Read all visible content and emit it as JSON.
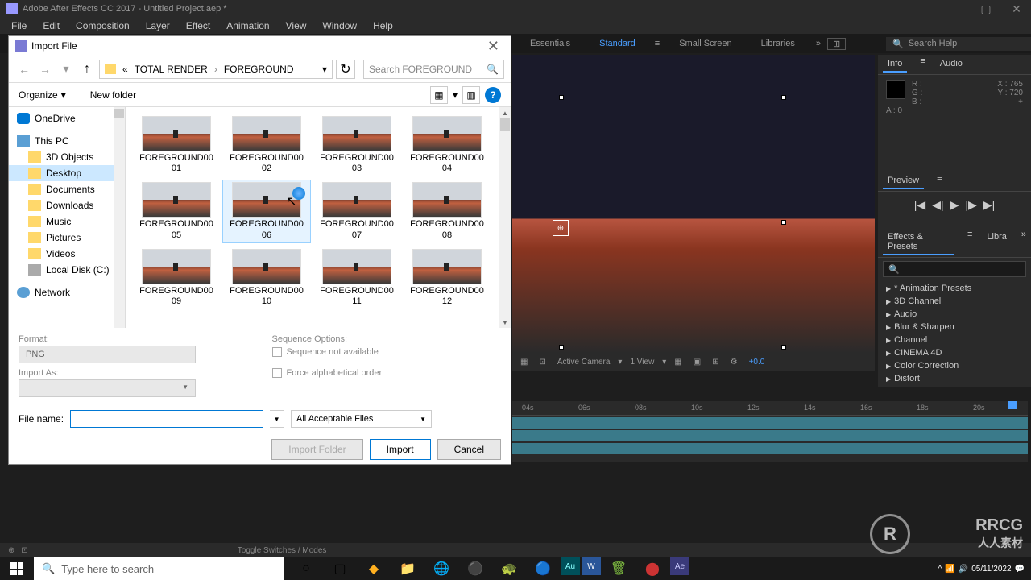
{
  "title_bar": {
    "title": "Adobe After Effects CC 2017 - Untitled Project.aep *"
  },
  "menu": {
    "items": [
      "File",
      "Edit",
      "Composition",
      "Layer",
      "Effect",
      "Animation",
      "View",
      "Window",
      "Help"
    ]
  },
  "workspace": {
    "tabs": [
      "Essentials",
      "Standard",
      "Small Screen",
      "Libraries"
    ],
    "active": "Standard",
    "search_placeholder": "Search Help"
  },
  "dialog": {
    "title": "Import File",
    "breadcrumb": {
      "prefix": "«",
      "parts": [
        "TOTAL RENDER",
        "FOREGROUND"
      ]
    },
    "search_placeholder": "Search FOREGROUND",
    "organize": "Organize",
    "new_folder": "New folder",
    "sidebar": {
      "items": [
        {
          "label": "OneDrive",
          "icon": "onedrive",
          "root": true
        },
        {
          "label": "This PC",
          "icon": "pc",
          "root": true
        },
        {
          "label": "3D Objects",
          "icon": "folder"
        },
        {
          "label": "Desktop",
          "icon": "folder",
          "selected": true
        },
        {
          "label": "Documents",
          "icon": "folder"
        },
        {
          "label": "Downloads",
          "icon": "folder"
        },
        {
          "label": "Music",
          "icon": "folder"
        },
        {
          "label": "Pictures",
          "icon": "folder"
        },
        {
          "label": "Videos",
          "icon": "folder"
        },
        {
          "label": "Local Disk (C:)",
          "icon": "drive"
        },
        {
          "label": "Network",
          "icon": "network",
          "root": true
        }
      ]
    },
    "files": [
      {
        "name": "FOREGROUND0001"
      },
      {
        "name": "FOREGROUND0002"
      },
      {
        "name": "FOREGROUND0003"
      },
      {
        "name": "FOREGROUND0004"
      },
      {
        "name": "FOREGROUND0005"
      },
      {
        "name": "FOREGROUND0006",
        "hover": true
      },
      {
        "name": "FOREGROUND0007"
      },
      {
        "name": "FOREGROUND0008"
      },
      {
        "name": "FOREGROUND0009"
      },
      {
        "name": "FOREGROUND0010"
      },
      {
        "name": "FOREGROUND0011"
      },
      {
        "name": "FOREGROUND0012"
      }
    ],
    "format_label": "Format:",
    "format_value": "PNG",
    "import_as_label": "Import As:",
    "import_as_value": "",
    "sequence_label": "Sequence Options:",
    "sequence_checkbox": "Sequence not available",
    "force_alpha": "Force alphabetical order",
    "filename_label": "File name:",
    "filename_value": "",
    "filetype": "All Acceptable Files",
    "btn_import_folder": "Import Folder",
    "btn_import": "Import",
    "btn_cancel": "Cancel"
  },
  "info_panel": {
    "tab_info": "Info",
    "tab_audio": "Audio",
    "r": "R :",
    "g": "G :",
    "b": "B :",
    "a": "A : 0",
    "x": "X : 765",
    "y": "Y : 720",
    "plus": "+"
  },
  "preview_panel": {
    "title": "Preview"
  },
  "effects_panel": {
    "title": "Effects & Presets",
    "tab2": "Libra",
    "categories": [
      "* Animation Presets",
      "3D Channel",
      "Audio",
      "Blur & Sharpen",
      "Channel",
      "CINEMA 4D",
      "Color Correction",
      "Distort"
    ]
  },
  "viewport": {
    "camera": "Active Camera",
    "view": "1 View",
    "exposure": "+0.0"
  },
  "timeline": {
    "ticks": [
      "04s",
      "06s",
      "08s",
      "10s",
      "12s",
      "14s",
      "16s",
      "18s",
      "20s"
    ]
  },
  "status": {
    "toggle": "Toggle Switches / Modes"
  },
  "taskbar": {
    "search": "Type here to search",
    "time": "",
    "date": "05/11/2022"
  },
  "watermark": {
    "text1": "RRCG",
    "text2": "人人素材",
    "circle": "R"
  }
}
